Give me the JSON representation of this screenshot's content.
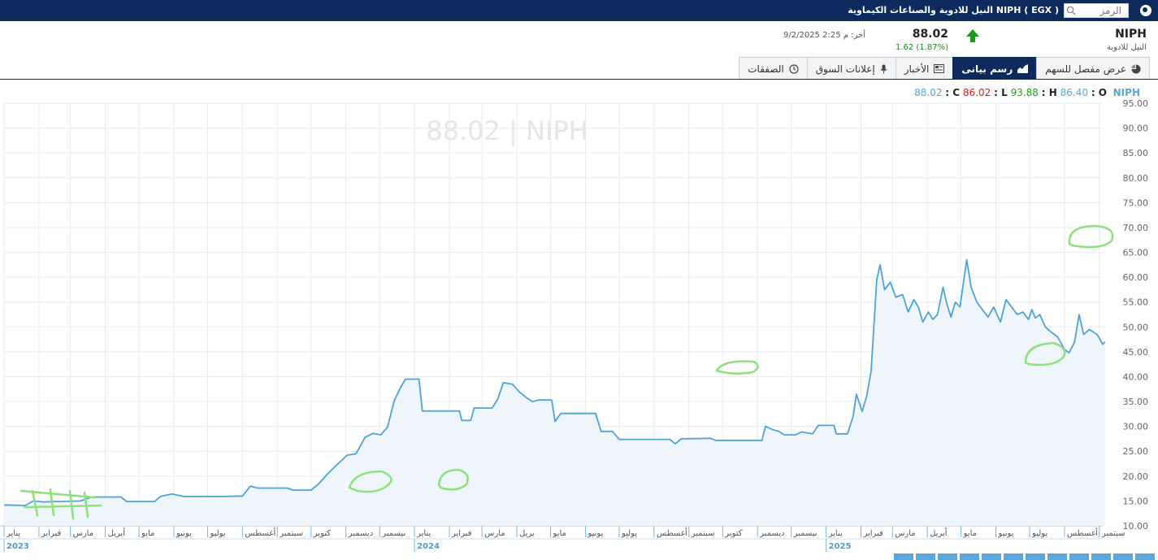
{
  "topbar": {
    "title": "NIPH ( EGX ) النيل للادوية والصناعات الكيماوية",
    "search_placeholder": "الرمز"
  },
  "header": {
    "symbol": "NIPH",
    "name_ar": "النيل للادوية",
    "last": "88.02",
    "change": "1.62",
    "change_pct": "(1.87%)",
    "last_label": "أخر:",
    "time": "م 2:25 9/2/2025"
  },
  "tabs": [
    {
      "label": "عرض مفصل للسهم",
      "icon": "pie-icon"
    },
    {
      "label": "رسم بيانى",
      "icon": "area-chart-icon",
      "active": true
    },
    {
      "label": "الأخبار",
      "icon": "newspaper-icon"
    },
    {
      "label": "إعلانات السوق",
      "icon": "microphone-icon"
    },
    {
      "label": "الصفقات",
      "icon": "clock-icon"
    }
  ],
  "ohlc": {
    "symbol": "NIPH",
    "o_label": "O",
    "o": "86.40",
    "h_label": "H",
    "h": "93.88",
    "l_label": "L",
    "l": "86.02",
    "c_label": "C",
    "c": "88.02"
  },
  "chart_data": {
    "type": "area",
    "watermark": "88.02 | NIPH",
    "ylim": [
      10,
      95
    ],
    "y_ticks": [
      "10.00",
      "15.00",
      "20.00",
      "25.00",
      "30.00",
      "35.00",
      "40.00",
      "45.00",
      "50.00",
      "55.00",
      "60.00",
      "65.00",
      "70.00",
      "75.00",
      "80.00",
      "85.00",
      "90.00",
      "95.00"
    ],
    "x_range": [
      "2023-01-01",
      "2025-09-04"
    ],
    "month_labels": [
      {
        "date": "2023-01-01",
        "label": "يناير"
      },
      {
        "date": "2023-02-01",
        "label": "فبراير"
      },
      {
        "date": "2023-03-01",
        "label": "مارس"
      },
      {
        "date": "2023-04-01",
        "label": "أبريل"
      },
      {
        "date": "2023-05-01",
        "label": "مايو"
      },
      {
        "date": "2023-06-01",
        "label": "يونيو"
      },
      {
        "date": "2023-07-01",
        "label": "يوليو"
      },
      {
        "date": "2023-08-01",
        "label": "أغسطس"
      },
      {
        "date": "2023-09-01",
        "label": "سبتمبر"
      },
      {
        "date": "2023-10-01",
        "label": "كتوبر"
      },
      {
        "date": "2023-11-01",
        "label": "ديسمبر"
      },
      {
        "date": "2023-12-01",
        "label": "نيسمبر"
      },
      {
        "date": "2024-01-01",
        "label": "يناير"
      },
      {
        "date": "2024-02-01",
        "label": "فبراير"
      },
      {
        "date": "2024-03-01",
        "label": "مارس"
      },
      {
        "date": "2024-04-01",
        "label": "بريل"
      },
      {
        "date": "2024-05-01",
        "label": "مايو"
      },
      {
        "date": "2024-06-01",
        "label": "يونيو"
      },
      {
        "date": "2024-07-01",
        "label": "يوليو"
      },
      {
        "date": "2024-08-01",
        "label": "أغسطس"
      },
      {
        "date": "2024-09-01",
        "label": "سبتمبر"
      },
      {
        "date": "2024-10-01",
        "label": "كتوبر"
      },
      {
        "date": "2024-11-01",
        "label": "ديسمبر"
      },
      {
        "date": "2024-12-01",
        "label": "نيسمبر"
      },
      {
        "date": "2025-01-01",
        "label": "يناير"
      },
      {
        "date": "2025-02-01",
        "label": "فبراير"
      },
      {
        "date": "2025-03-01",
        "label": "مارس"
      },
      {
        "date": "2025-04-01",
        "label": "أبريل"
      },
      {
        "date": "2025-05-01",
        "label": "مايو"
      },
      {
        "date": "2025-06-01",
        "label": "يونيو"
      },
      {
        "date": "2025-07-01",
        "label": "يوليو"
      },
      {
        "date": "2025-08-01",
        "label": "أغسطس"
      },
      {
        "date": "2025-09-01",
        "label": "سبتمبر"
      }
    ],
    "year_labels": [
      {
        "date": "2023-01-01",
        "label": "2023"
      },
      {
        "date": "2024-01-01",
        "label": "2024"
      },
      {
        "date": "2025-01-01",
        "label": "2025"
      }
    ],
    "series": [
      {
        "color": "#4fa3d8",
        "fill": "#eef6fb",
        "points": [
          [
            "2023-01-01",
            14.2
          ],
          [
            "2023-01-20",
            14.1
          ],
          [
            "2023-01-27",
            15.0
          ],
          [
            "2023-02-05",
            14.8
          ],
          [
            "2023-02-20",
            14.9
          ],
          [
            "2023-03-10",
            15.0
          ],
          [
            "2023-03-20",
            15.8
          ],
          [
            "2023-04-15",
            15.8
          ],
          [
            "2023-04-20",
            14.9
          ],
          [
            "2023-05-15",
            14.9
          ],
          [
            "2023-05-20",
            15.9
          ],
          [
            "2023-05-30",
            16.4
          ],
          [
            "2023-06-10",
            15.9
          ],
          [
            "2023-07-15",
            15.9
          ],
          [
            "2023-08-01",
            16.0
          ],
          [
            "2023-08-08",
            18.0
          ],
          [
            "2023-08-15",
            17.6
          ],
          [
            "2023-09-10",
            17.6
          ],
          [
            "2023-09-15",
            17.2
          ],
          [
            "2023-10-01",
            17.2
          ],
          [
            "2023-10-08",
            18.5
          ],
          [
            "2023-10-15",
            20.3
          ],
          [
            "2023-10-25",
            22.5
          ],
          [
            "2023-11-02",
            24.2
          ],
          [
            "2023-11-10",
            24.5
          ],
          [
            "2023-11-18",
            27.8
          ],
          [
            "2023-11-25",
            28.6
          ],
          [
            "2023-12-02",
            28.3
          ],
          [
            "2023-12-08",
            29.9
          ],
          [
            "2023-12-14",
            35.2
          ],
          [
            "2023-12-20",
            38.0
          ],
          [
            "2023-12-24",
            39.5
          ],
          [
            "2024-01-05",
            39.5
          ],
          [
            "2024-01-08",
            33.1
          ],
          [
            "2024-02-10",
            33.1
          ],
          [
            "2024-02-12",
            31.2
          ],
          [
            "2024-02-20",
            31.2
          ],
          [
            "2024-02-23",
            33.7
          ],
          [
            "2024-03-10",
            33.7
          ],
          [
            "2024-03-15",
            35.5
          ],
          [
            "2024-03-20",
            38.8
          ],
          [
            "2024-03-28",
            38.5
          ],
          [
            "2024-04-03",
            37.0
          ],
          [
            "2024-04-10",
            35.7
          ],
          [
            "2024-04-15",
            35.0
          ],
          [
            "2024-04-20",
            35.3
          ],
          [
            "2024-05-02",
            35.3
          ],
          [
            "2024-05-05",
            31.0
          ],
          [
            "2024-05-10",
            32.6
          ],
          [
            "2024-06-10",
            32.6
          ],
          [
            "2024-06-15",
            29.0
          ],
          [
            "2024-06-25",
            29.0
          ],
          [
            "2024-07-01",
            27.4
          ],
          [
            "2024-08-15",
            27.4
          ],
          [
            "2024-08-20",
            26.5
          ],
          [
            "2024-08-25",
            27.5
          ],
          [
            "2024-09-20",
            27.6
          ],
          [
            "2024-09-25",
            27.2
          ],
          [
            "2024-11-05",
            27.2
          ],
          [
            "2024-11-08",
            30.0
          ],
          [
            "2024-11-15",
            29.3
          ],
          [
            "2024-11-20",
            29.0
          ],
          [
            "2024-11-25",
            28.3
          ],
          [
            "2024-12-05",
            28.3
          ],
          [
            "2024-12-10",
            28.9
          ],
          [
            "2024-12-20",
            28.5
          ],
          [
            "2024-12-25",
            30.2
          ],
          [
            "2025-01-08",
            30.2
          ],
          [
            "2025-01-10",
            28.5
          ],
          [
            "2025-01-20",
            28.5
          ],
          [
            "2025-01-25",
            32.0
          ],
          [
            "2025-01-28",
            36.5
          ],
          [
            "2025-02-02",
            33.0
          ],
          [
            "2025-02-06",
            36.0
          ],
          [
            "2025-02-10",
            41.0
          ],
          [
            "2025-02-15",
            59.5
          ],
          [
            "2025-02-18",
            62.5
          ],
          [
            "2025-02-22",
            57.5
          ],
          [
            "2025-02-27",
            59.0
          ],
          [
            "2025-03-04",
            56.0
          ],
          [
            "2025-03-10",
            56.5
          ],
          [
            "2025-03-15",
            53.0
          ],
          [
            "2025-03-20",
            55.5
          ],
          [
            "2025-03-24",
            54.0
          ],
          [
            "2025-03-28",
            51.0
          ],
          [
            "2025-04-02",
            53.0
          ],
          [
            "2025-04-06",
            51.5
          ],
          [
            "2025-04-10",
            52.5
          ],
          [
            "2025-04-15",
            58.0
          ],
          [
            "2025-04-18",
            55.0
          ],
          [
            "2025-04-22",
            52.0
          ],
          [
            "2025-04-26",
            55.0
          ],
          [
            "2025-04-30",
            54.0
          ],
          [
            "2025-05-06",
            63.5
          ],
          [
            "2025-05-10",
            58.0
          ],
          [
            "2025-05-15",
            55.0
          ],
          [
            "2025-05-20",
            53.5
          ],
          [
            "2025-05-25",
            52.0
          ],
          [
            "2025-05-30",
            54.0
          ],
          [
            "2025-06-05",
            51.0
          ],
          [
            "2025-06-10",
            55.5
          ],
          [
            "2025-06-15",
            54.0
          ],
          [
            "2025-06-20",
            52.5
          ],
          [
            "2025-06-25",
            53.0
          ],
          [
            "2025-06-30",
            51.5
          ],
          [
            "2025-07-03",
            53.5
          ],
          [
            "2025-07-06",
            51.8
          ],
          [
            "2025-07-10",
            52.5
          ],
          [
            "2025-07-15",
            50.0
          ],
          [
            "2025-07-20",
            49.0
          ],
          [
            "2025-07-26",
            48.0
          ],
          [
            "2025-08-01",
            45.5
          ],
          [
            "2025-08-05",
            44.8
          ],
          [
            "2025-08-10",
            47.0
          ],
          [
            "2025-08-14",
            52.5
          ],
          [
            "2025-08-18",
            48.5
          ],
          [
            "2025-08-23",
            49.5
          ],
          [
            "2025-08-30",
            48.5
          ],
          [
            "2025-09-04",
            46.5
          ],
          [
            "2025-09-06",
            47.0
          ]
        ]
      }
    ],
    "annotations": [
      "green-freehand-circles",
      "green-hatch-marks"
    ]
  }
}
